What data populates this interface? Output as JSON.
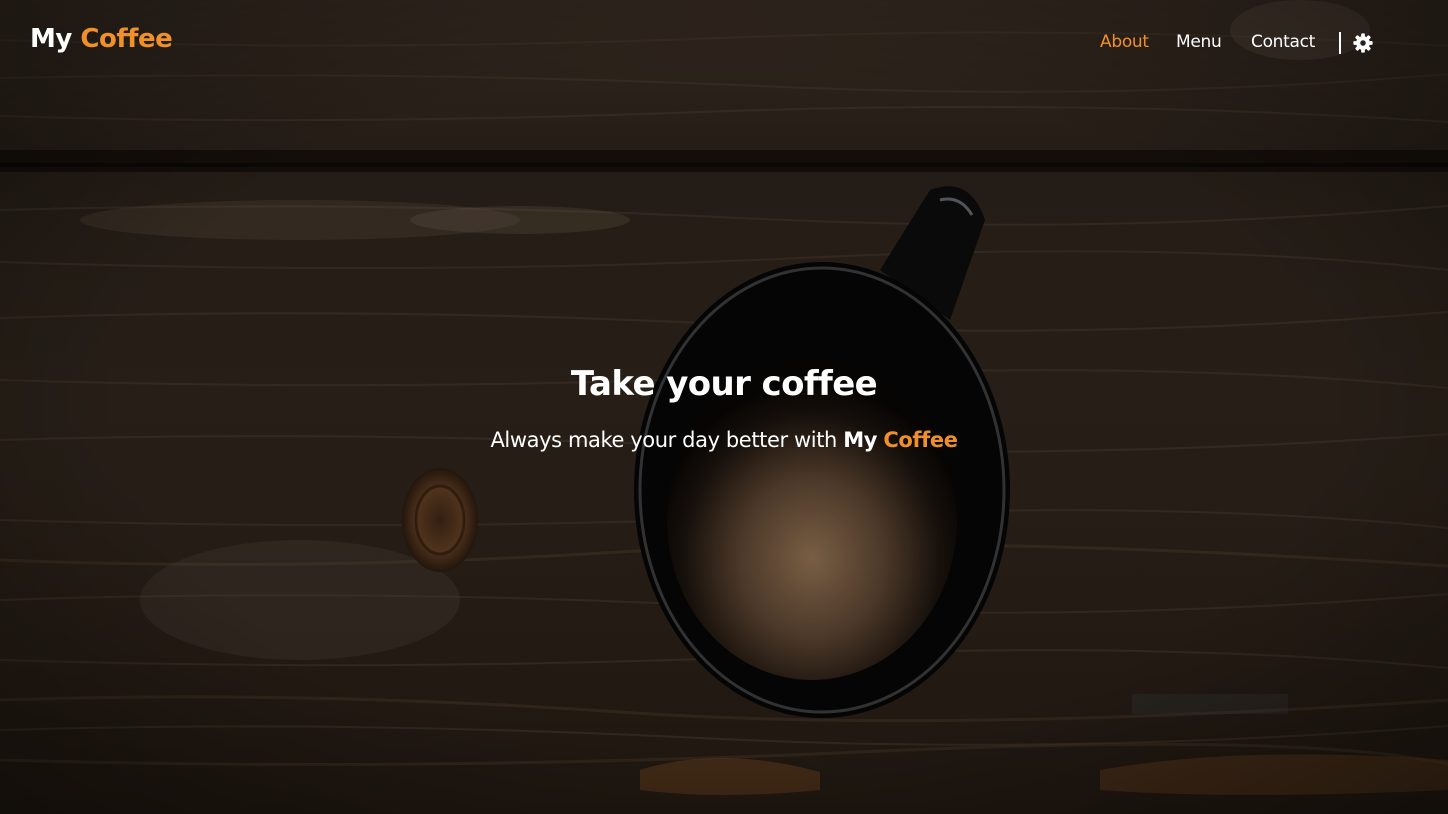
{
  "brand": {
    "part1": "My",
    "part2": "Coffee"
  },
  "nav": {
    "items": [
      {
        "label": "About",
        "active": true
      },
      {
        "label": "Menu",
        "active": false
      },
      {
        "label": "Contact",
        "active": false
      }
    ],
    "settings_icon": "gear-icon"
  },
  "hero": {
    "title": "Take your coffee",
    "subtitle_prefix": "Always make your day better with",
    "subtitle_brand1": "My",
    "subtitle_brand2": "Coffee",
    "background": "coffee-mug-on-dark-wooden-table"
  },
  "colors": {
    "accent": "#f0902a",
    "text": "#ffffff",
    "background": "#2a2119"
  }
}
